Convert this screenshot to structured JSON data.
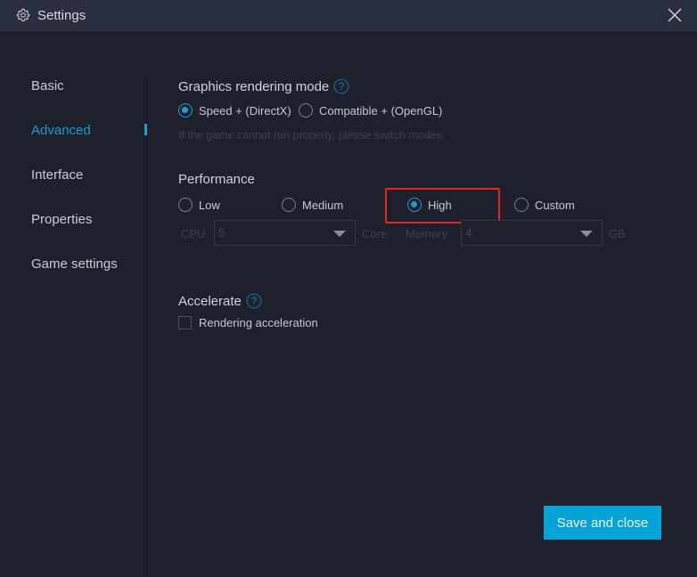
{
  "window": {
    "title": "Settings",
    "title_icon": "gear-icon",
    "close_icon": "close-icon"
  },
  "sidebar": {
    "items": [
      {
        "label": "Basic",
        "active": false
      },
      {
        "label": "Advanced",
        "active": true
      },
      {
        "label": "Interface",
        "active": false
      },
      {
        "label": "Properties",
        "active": false
      },
      {
        "label": "Game settings",
        "active": false
      }
    ]
  },
  "rendering": {
    "title": "Graphics rendering mode",
    "help_icon": "question-circle-icon",
    "options": [
      {
        "label": "Speed + (DirectX)",
        "checked": true
      },
      {
        "label": "Compatible + (OpenGL)",
        "checked": false
      }
    ],
    "hint": "If the game cannot run properly, please switch modes."
  },
  "performance": {
    "title": "Performance",
    "options": [
      {
        "label": "Low",
        "checked": false
      },
      {
        "label": "Medium",
        "checked": false
      },
      {
        "label": "High",
        "checked": true
      },
      {
        "label": "Custom",
        "checked": false
      }
    ],
    "cpu_label": "CPU",
    "cpu_value": "5",
    "cpu_unit": "Core",
    "memory_label": "Memory",
    "memory_value": "4",
    "memory_unit": "GB"
  },
  "accelerate": {
    "title": "Accelerate",
    "help_icon": "question-circle-icon",
    "checkbox_label": "Rendering acceleration",
    "checked": false
  },
  "footer": {
    "save_label": "Save and close"
  },
  "colors": {
    "accent": "#1e9bd7",
    "button": "#05a3d6",
    "highlight": "#e8251f",
    "background": "#1e212b",
    "titlebar": "#2a2f3f"
  }
}
